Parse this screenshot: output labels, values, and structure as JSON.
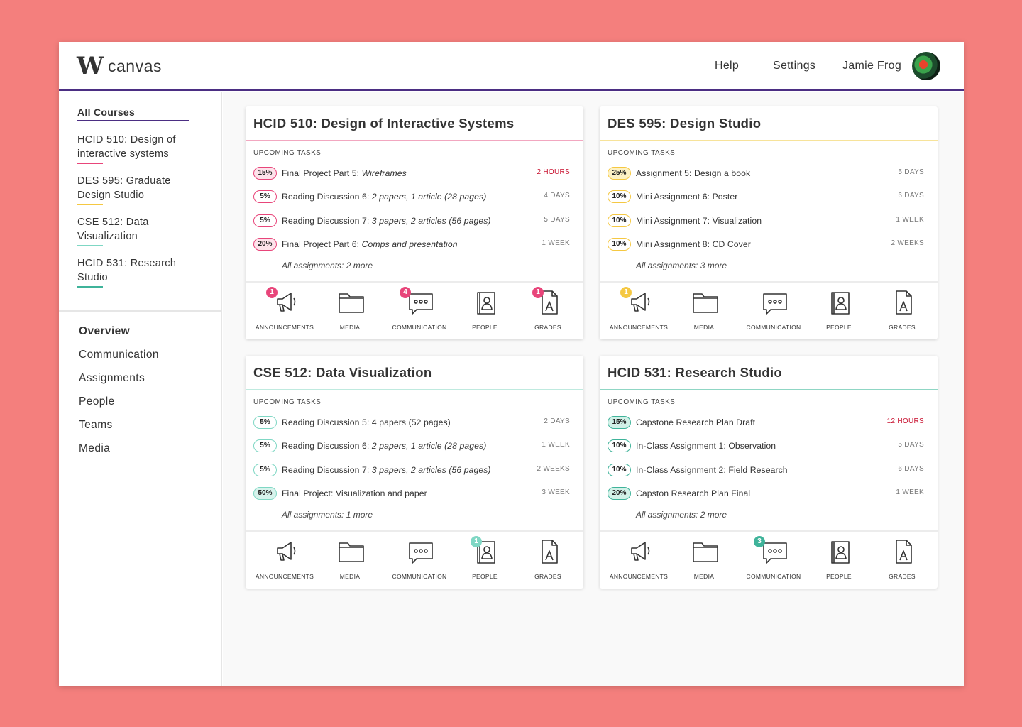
{
  "header": {
    "logo_mark": "W",
    "logo_text": "canvas",
    "nav": [
      "Help",
      "Settings",
      "Jamie Frog"
    ]
  },
  "sidebar": {
    "all_courses": "All Courses",
    "courses": [
      {
        "label": "HCID 510: Design of interactive systems",
        "color": "#e8457a"
      },
      {
        "label": "DES 595: Graduate Design Studio",
        "color": "#f5c842"
      },
      {
        "label": "CSE 512: Data Visualization",
        "color": "#7fd7c4"
      },
      {
        "label": "HCID 531: Research Studio",
        "color": "#3fb39a"
      }
    ],
    "nav": [
      "Overview",
      "Communication",
      "Assignments",
      "People",
      "Teams",
      "Media"
    ]
  },
  "tool_labels": [
    "ANNOUNCEMENTS",
    "MEDIA",
    "COMMUNICATION",
    "PEOPLE",
    "GRADES"
  ],
  "cards": [
    {
      "title": "HCID 510: Design of Interactive Systems",
      "accent": "#f2a7c0",
      "pill_bg": "#fde3eb",
      "pill_border": "#e8457a",
      "upcoming": "UPCOMING TASKS",
      "tasks": [
        {
          "pct": "15%",
          "name": "Final Project Part 5: ",
          "detail": "Wireframes",
          "due": "2 HOURS",
          "urgent": true,
          "fill": true
        },
        {
          "pct": "5%",
          "name": "Reading Discussion 6: ",
          "detail": "2 papers, 1 article (28 pages)",
          "due": "4 DAYS",
          "urgent": false,
          "fill": false
        },
        {
          "pct": "5%",
          "name": "Reading Discussion 7: ",
          "detail": "3 papers, 2 articles (56 pages)",
          "due": "5 DAYS",
          "urgent": false,
          "fill": false
        },
        {
          "pct": "20%",
          "name": "Final Project Part 6: ",
          "detail": "Comps and presentation",
          "due": "1 WEEK",
          "urgent": false,
          "fill": true
        }
      ],
      "more": "All assignments: 2 more",
      "badge_color": "#e8457a",
      "badges": [
        "1",
        "",
        "4",
        "",
        "1"
      ]
    },
    {
      "title": "DES 595: Design Studio",
      "accent": "#f7e39a",
      "pill_bg": "#fdf1c4",
      "pill_border": "#f5c842",
      "upcoming": "UPCOMING TASKS",
      "tasks": [
        {
          "pct": "25%",
          "name": "Assignment 5: Design a book",
          "detail": "",
          "due": "5 DAYS",
          "urgent": false,
          "fill": true
        },
        {
          "pct": "10%",
          "name": "Mini Assignment 6: Poster",
          "detail": "",
          "due": "6 DAYS",
          "urgent": false,
          "fill": false
        },
        {
          "pct": "10%",
          "name": "Mini Assignment 7: Visualization",
          "detail": "",
          "due": "1 WEEK",
          "urgent": false,
          "fill": false
        },
        {
          "pct": "10%",
          "name": "Mini Assignment 8: CD Cover",
          "detail": "",
          "due": "2 WEEKS",
          "urgent": false,
          "fill": false
        }
      ],
      "more": "All assignments: 3 more",
      "badge_color": "#f5c842",
      "badges": [
        "",
        "1",
        "",
        "",
        ""
      ]
    },
    {
      "title": "CSE 512: Data Visualization",
      "accent": "#bfeadf",
      "pill_bg": "#d7f3ec",
      "pill_border": "#7fd7c4",
      "upcoming": "UPCOMING TASKS",
      "tasks": [
        {
          "pct": "5%",
          "name": "Reading Discussion 5: 4 papers (52 pages)",
          "detail": "",
          "due": "2 DAYS",
          "urgent": false,
          "fill": false
        },
        {
          "pct": "5%",
          "name": "Reading Discussion 6: ",
          "detail": "2 papers, 1 article (28 pages)",
          "due": "1 WEEK",
          "urgent": false,
          "fill": false
        },
        {
          "pct": "5%",
          "name": "Reading Discussion 7: ",
          "detail": "3 papers, 2 articles (56 pages)",
          "due": "2 WEEKS",
          "urgent": false,
          "fill": false
        },
        {
          "pct": "50%",
          "name": "Final Project: Visualization and paper",
          "detail": "",
          "due": "3 WEEK",
          "urgent": false,
          "fill": true
        }
      ],
      "more": "All assignments: 1 more",
      "badge_color": "#7fd7c4",
      "badges": [
        "",
        "",
        "",
        "1",
        ""
      ]
    },
    {
      "title": "HCID 531: Research Studio",
      "accent": "#8fd6c4",
      "pill_bg": "#d2f1e8",
      "pill_border": "#3fb39a",
      "upcoming": "UPCOMING TASKS",
      "tasks": [
        {
          "pct": "15%",
          "name": "Capstone Research Plan Draft",
          "detail": "",
          "due": "12 HOURS",
          "urgent": true,
          "fill": true
        },
        {
          "pct": "10%",
          "name": "In-Class Assignment 1: Observation",
          "detail": "",
          "due": "5 DAYS",
          "urgent": false,
          "fill": false
        },
        {
          "pct": "10%",
          "name": "In-Class Assignment 2: Field Research",
          "detail": "",
          "due": "6 DAYS",
          "urgent": false,
          "fill": false
        },
        {
          "pct": "20%",
          "name": "Capston Research Plan Final",
          "detail": "",
          "due": "1 WEEK",
          "urgent": false,
          "fill": true
        }
      ],
      "more": "All assignments: 2 more",
      "badge_color": "#3fb39a",
      "badges": [
        "",
        "",
        "3",
        "",
        ""
      ]
    }
  ]
}
